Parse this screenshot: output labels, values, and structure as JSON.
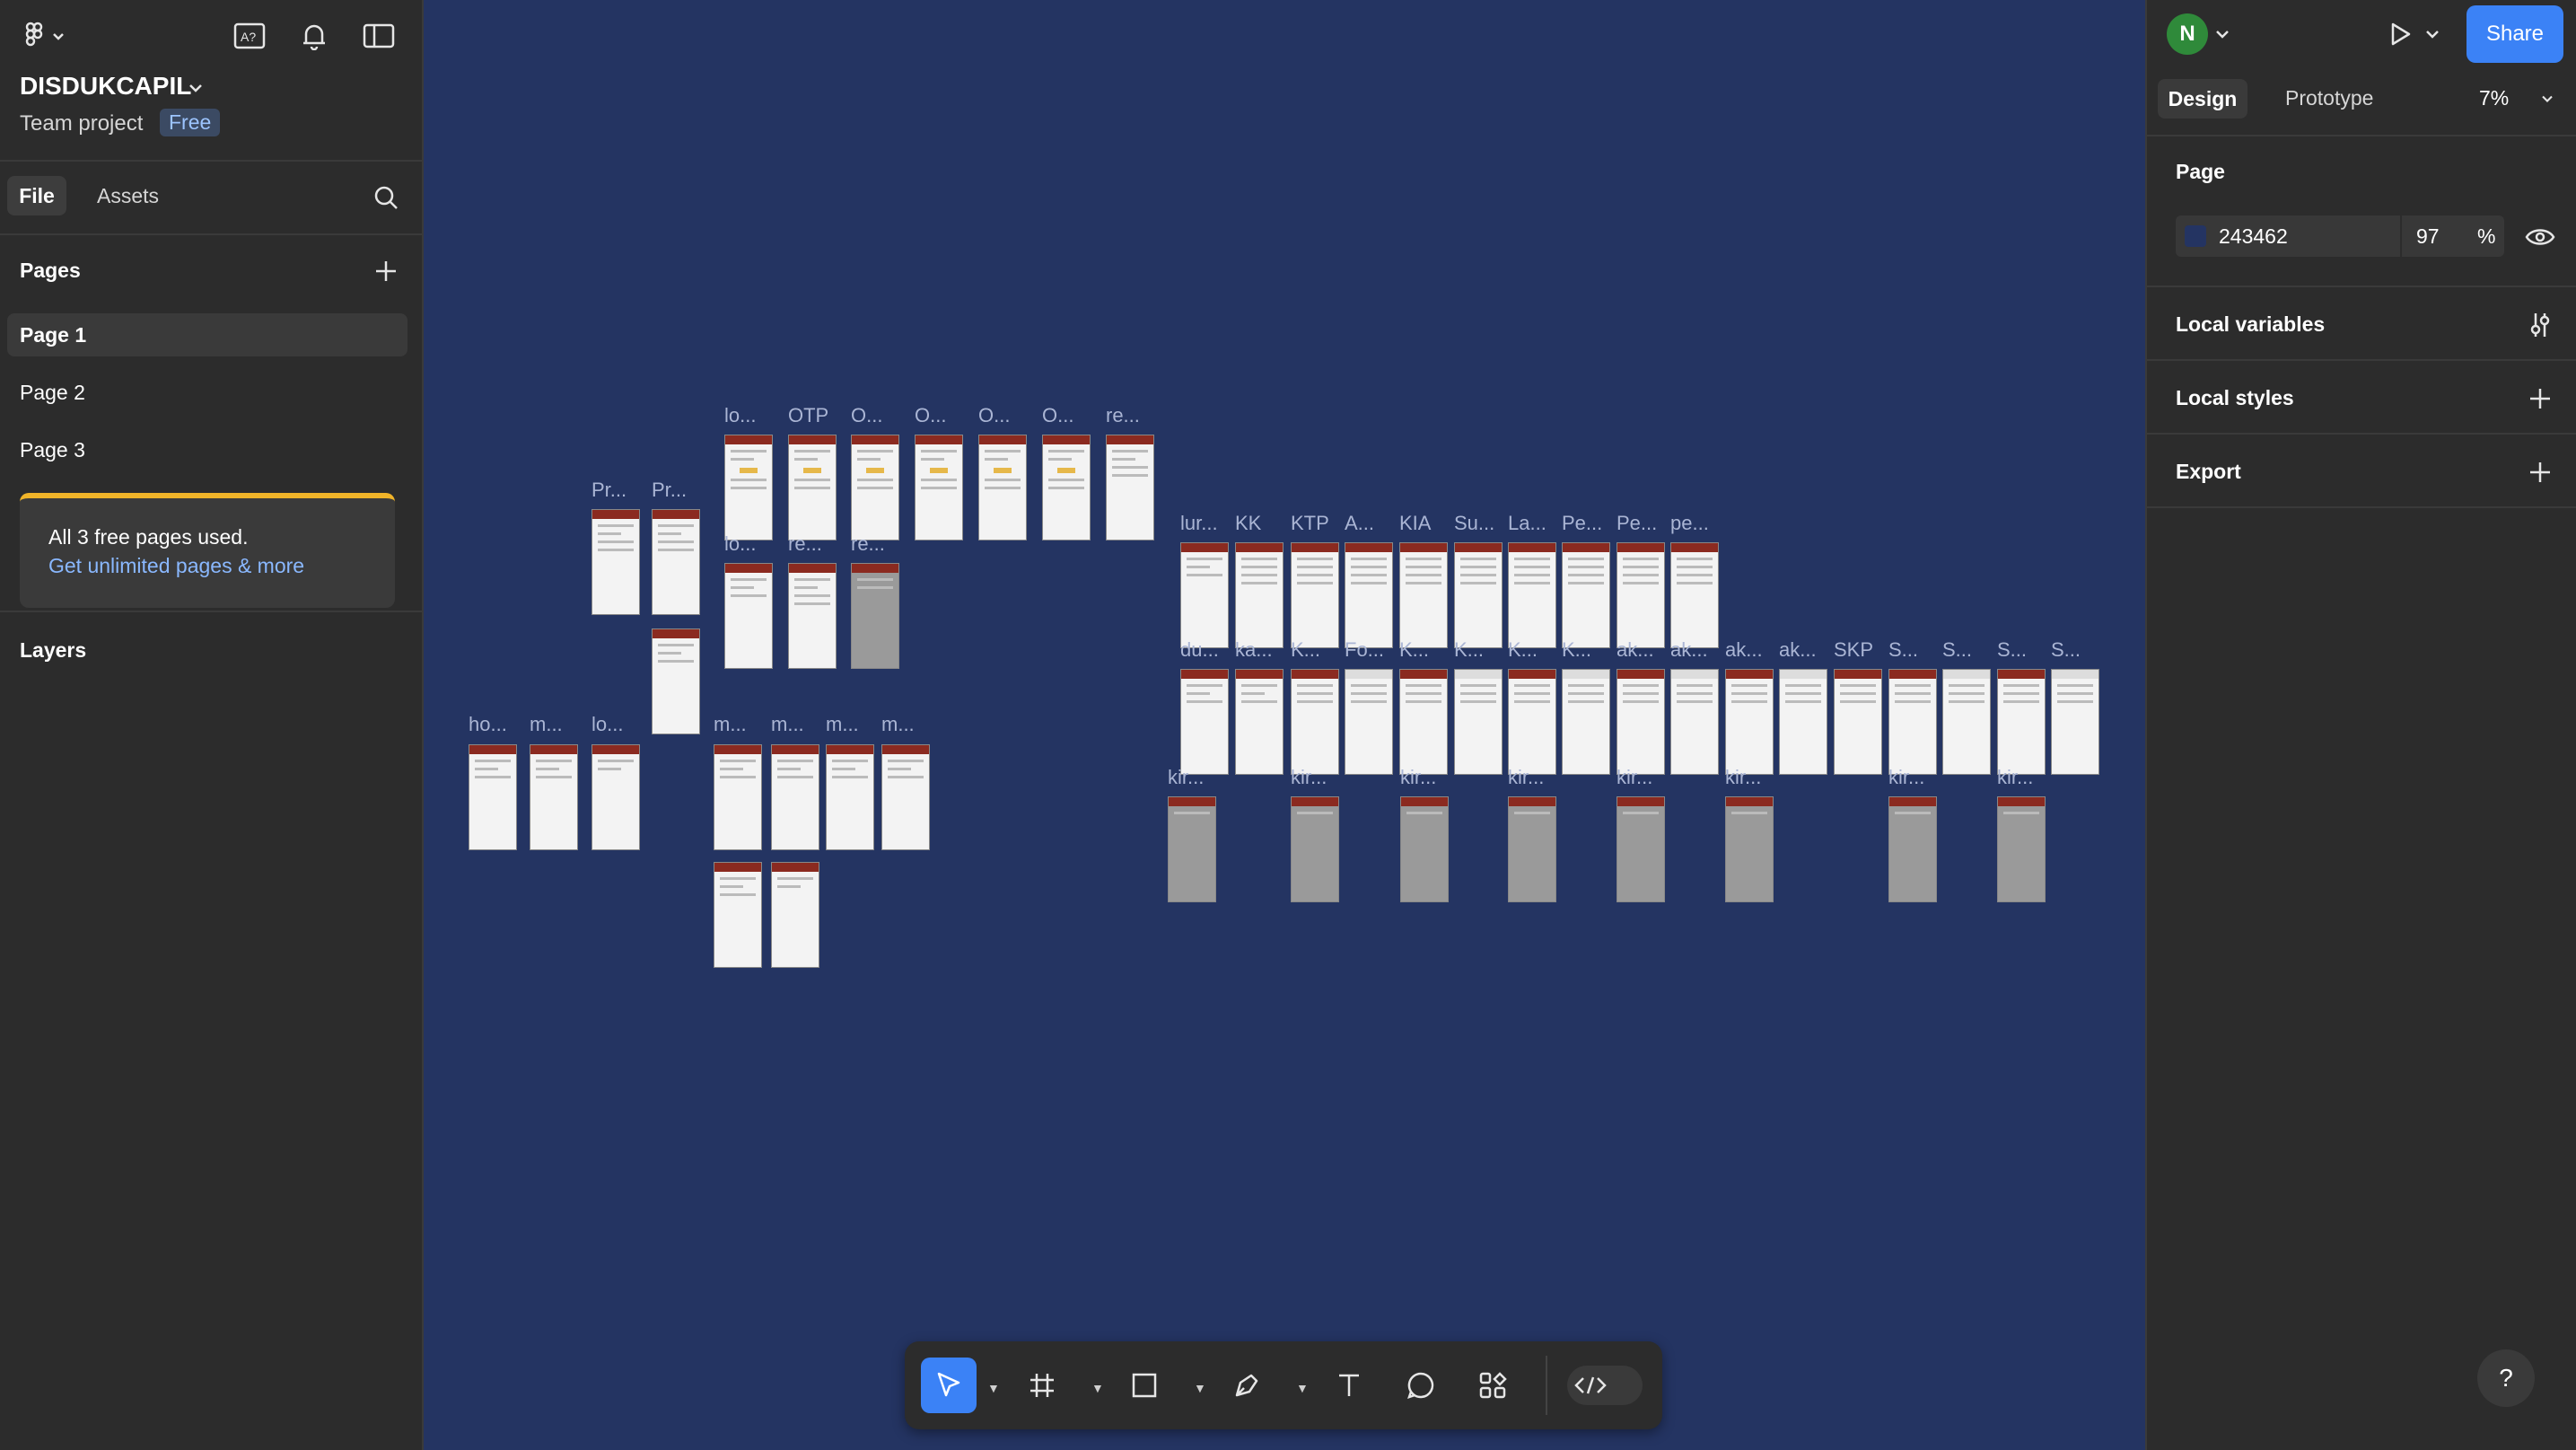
{
  "project": {
    "name": "DISDUKCAPIL",
    "subtitle": "Team project",
    "plan_badge": "Free"
  },
  "left_tabs": {
    "file": "File",
    "assets": "Assets"
  },
  "pages": {
    "heading": "Pages",
    "items": [
      "Page 1",
      "Page 2",
      "Page 3"
    ],
    "selected": "Page 1",
    "notice": "All 3 free pages used.",
    "notice_link": "Get unlimited pages & more"
  },
  "layers": {
    "heading": "Layers"
  },
  "right": {
    "user_initial": "N",
    "share": "Share",
    "tabs": {
      "design": "Design",
      "prototype": "Prototype"
    },
    "zoom": "7%",
    "page_heading": "Page",
    "bg_hex": "243462",
    "bg_opacity": "97",
    "percent_sign": "%",
    "local_variables": "Local variables",
    "local_styles": "Local styles",
    "export": "Export"
  },
  "canvas": {
    "background": "#243462",
    "frame_labels": {
      "a1": "lo...",
      "a2": "OTP",
      "a3": "O...",
      "a4": "O...",
      "a5": "O...",
      "a6": "O...",
      "a7": "re...",
      "b1": "Pr...",
      "b2": "Pr...",
      "c1": "lo...",
      "c2": "re...",
      "c3": "re...",
      "d1": "ho...",
      "d2": "m...",
      "d3": "lo...",
      "d4": "m...",
      "d5": "m...",
      "d6": "m...",
      "d7": "m...",
      "e1": "lur...",
      "e2": "KK",
      "e3": "KTP",
      "e4": "A...",
      "e5": "KIA",
      "e6": "Su...",
      "e7": "La...",
      "e8": "Pe...",
      "e9": "Pe...",
      "e10": "pe...",
      "f1": "du...",
      "f2": "ka...",
      "f3": "K...",
      "f4": "Fo...",
      "f5": "K...",
      "f6": "K...",
      "f7": "K...",
      "f8": "K...",
      "f9": "ak...",
      "f10": "ak...",
      "f11": "ak...",
      "f12": "ak...",
      "f13": "SKP",
      "f14": "S...",
      "f15": "S...",
      "f16": "S...",
      "f17": "S...",
      "g1": "kir...",
      "g2": "kir...",
      "g3": "kir...",
      "g4": "kir...",
      "g5": "kir...",
      "g6": "kir...",
      "g7": "kir...",
      "g8": "kir..."
    }
  },
  "toolbar": {
    "tools": [
      "move-tool",
      "frame-tool",
      "shape-tool",
      "pen-tool",
      "text-tool",
      "comment-tool",
      "actions-tool",
      "dev-mode"
    ]
  },
  "help": "?",
  "colors": {
    "accent": "#3b82f6",
    "panel": "#2c2c2c",
    "notice_bar": "#f0b429"
  }
}
